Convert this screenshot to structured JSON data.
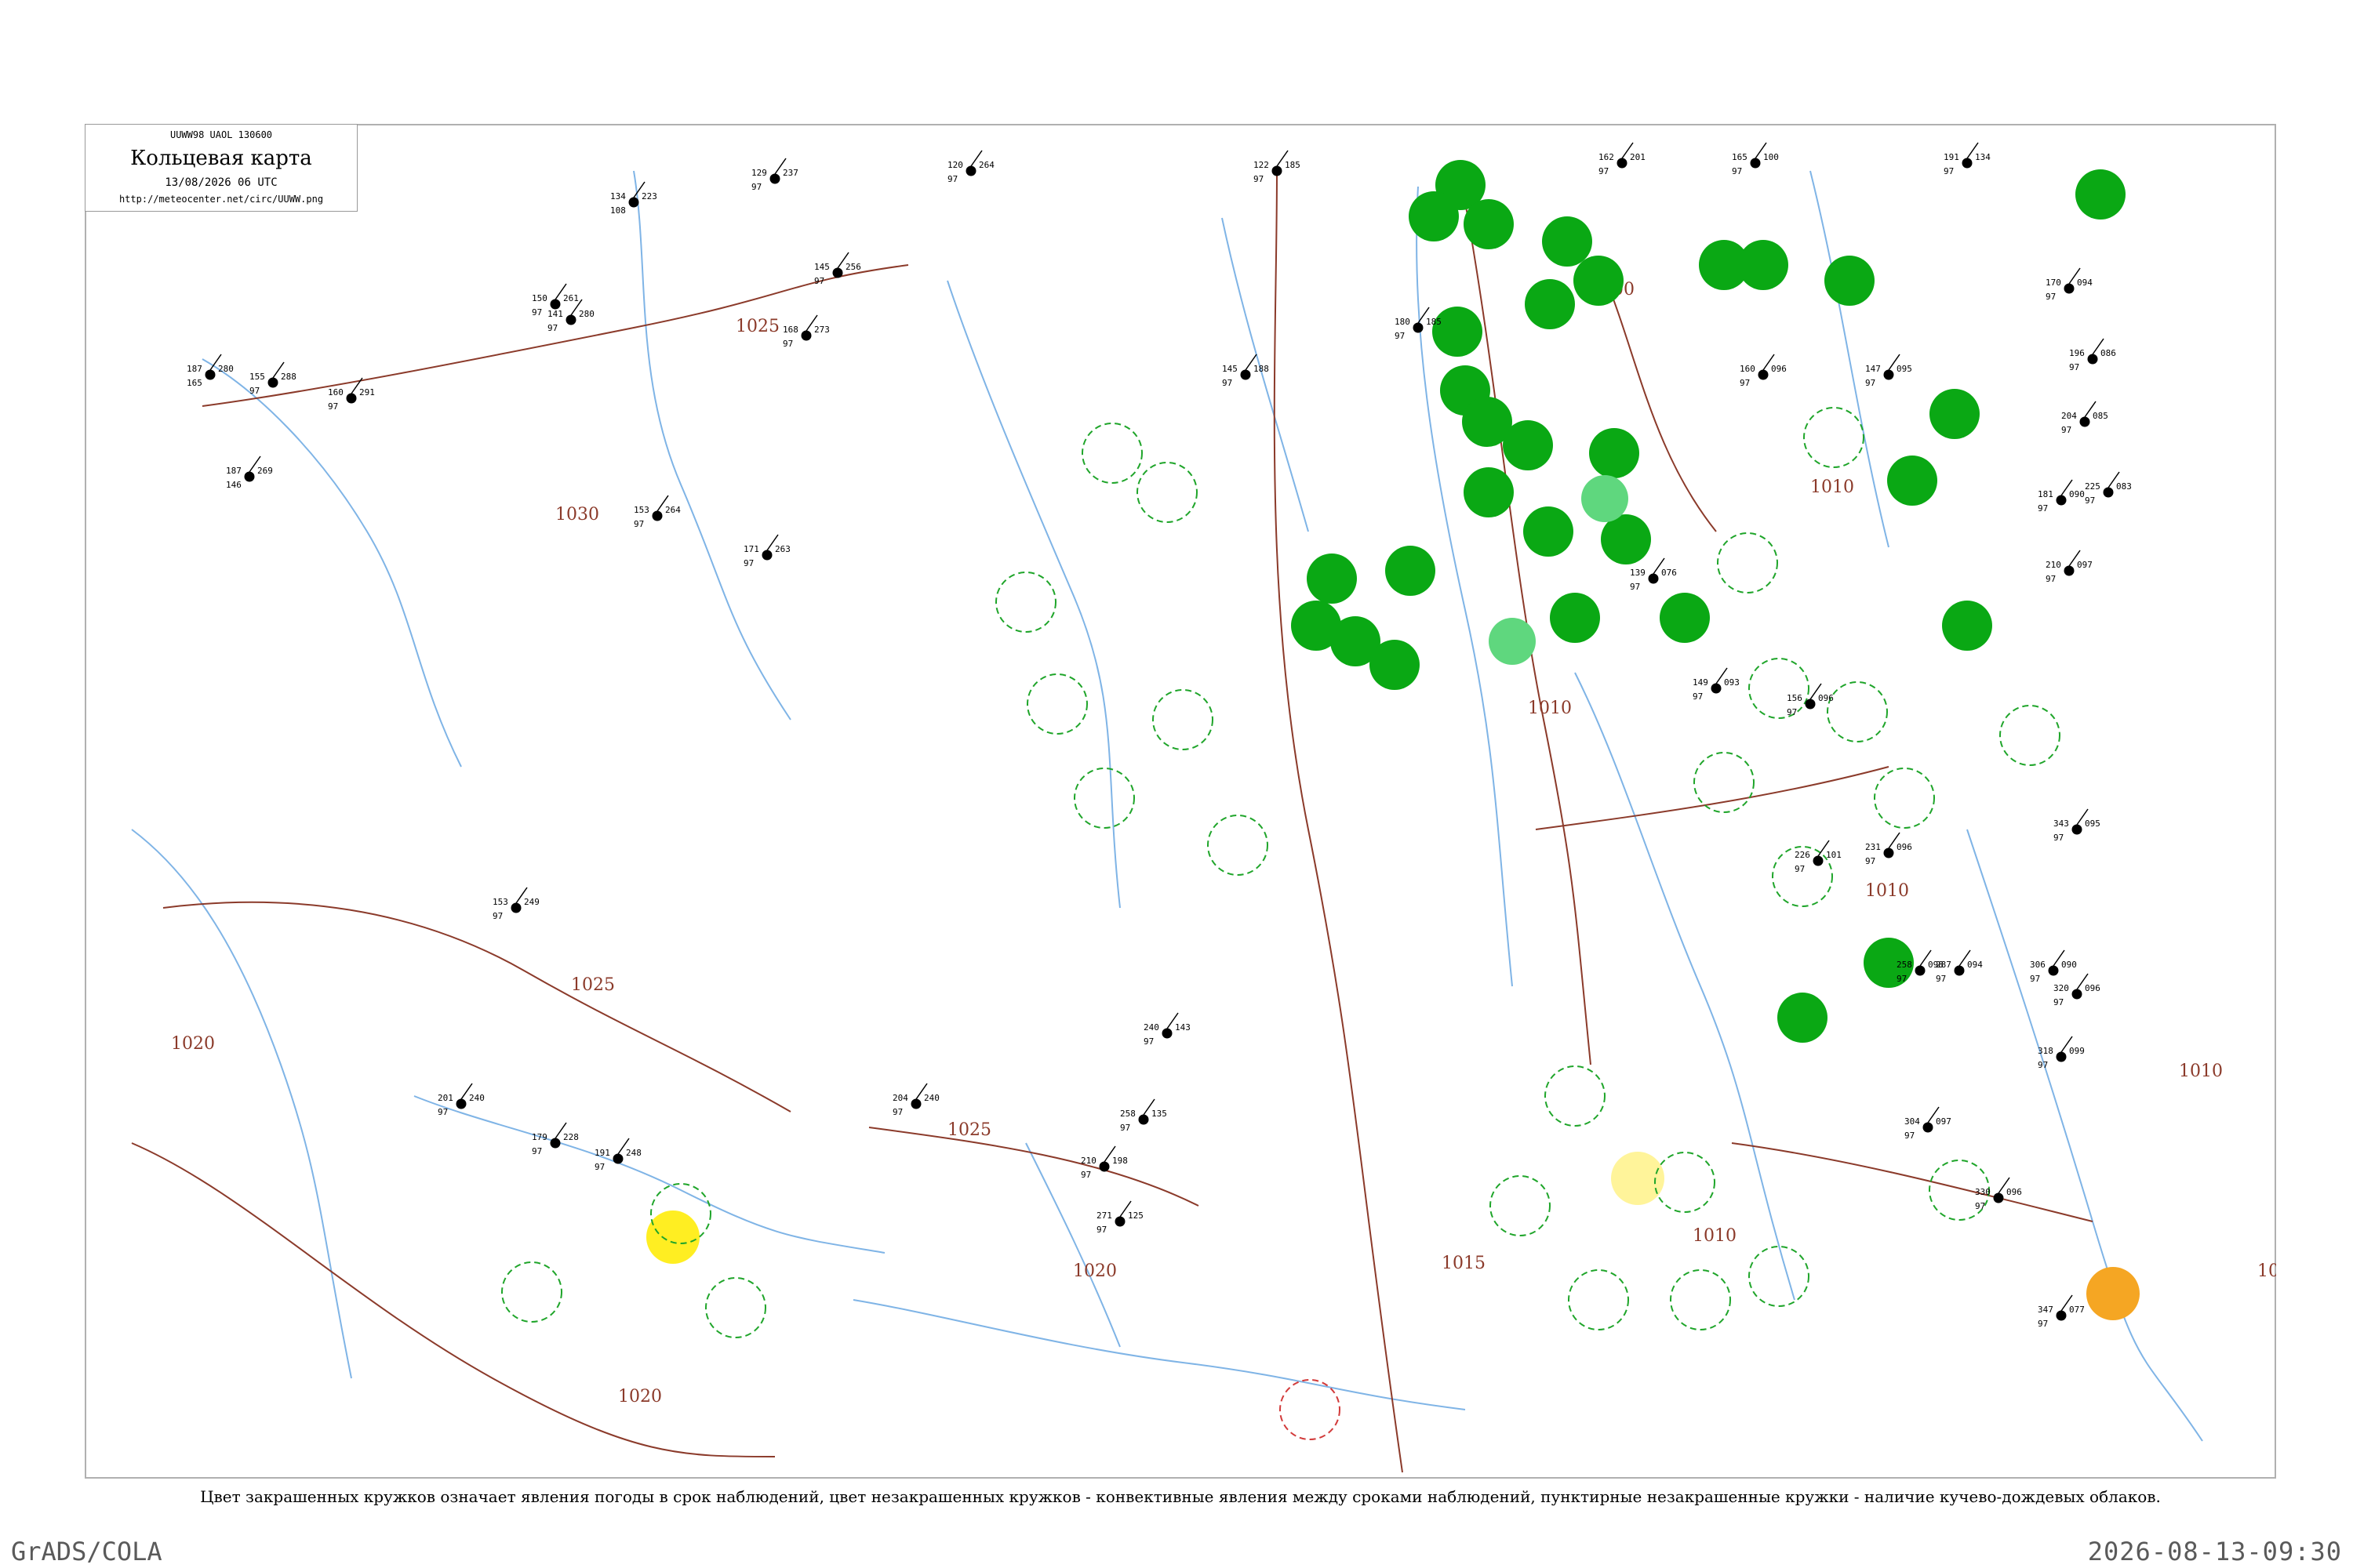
{
  "header": {
    "code": "UUWW98  UAOL  130600",
    "title": "Кольцевая карта",
    "datetime": "13/08/2026 06 UTC",
    "url": "http://meteocenter.net/circ/UUWW.png"
  },
  "caption": "Цвет закрашенных кружков означает явления погоды в срок наблюдений, цвет незакрашенных кружков - конвективные явления между сроками наблюдений, пунктирные незакрашенные кружки - наличие кучево-дождевых облаков.",
  "footer": {
    "software": "GrADS/COLA",
    "timestamp": "2026-08-13-09:30"
  },
  "isobars": [
    "1030",
    "1025",
    "1025",
    "1025",
    "1020",
    "1020",
    "1020",
    "1015",
    "1010",
    "1010",
    "1010",
    "1010",
    "1000",
    "1010",
    "10"
  ],
  "colors": {
    "frame": "#b0b0b0",
    "river": "#7fb4e6",
    "isobar": "#8b3a2a",
    "rain_fill": "#0aa814",
    "light_rain_fill": "#5fd77e",
    "fog_fill": "#ffee22",
    "haze_fill": "#fff49a",
    "dust_fill": "#f5a623",
    "convective_ring": "#1fa52a",
    "thunder_ring": "#d23a3a",
    "station_text": "#000000"
  },
  "stations": [
    {
      "t": "134",
      "p": "223",
      "d": "108"
    },
    {
      "t": "129",
      "p": "237",
      "d": "97"
    },
    {
      "t": "187",
      "p": "280",
      "d": "165"
    },
    {
      "t": "155",
      "p": "288",
      "d": "97"
    },
    {
      "t": "160",
      "p": "291",
      "d": "97"
    },
    {
      "t": "150",
      "p": "261",
      "d": "97"
    },
    {
      "t": "168",
      "p": "273",
      "d": "97"
    },
    {
      "t": "145",
      "p": "256",
      "d": "97"
    },
    {
      "t": "120",
      "p": "264",
      "d": "97"
    },
    {
      "t": "187",
      "p": "269",
      "d": "146"
    },
    {
      "t": "122",
      "p": "185",
      "d": "97"
    },
    {
      "t": "162",
      "p": "201",
      "d": "97"
    },
    {
      "t": "160",
      "p": "096",
      "d": "97"
    },
    {
      "t": "147",
      "p": "095",
      "d": "97"
    },
    {
      "t": "170",
      "p": "094",
      "d": "97"
    },
    {
      "t": "196",
      "p": "086",
      "d": "97"
    },
    {
      "t": "204",
      "p": "085",
      "d": "97"
    },
    {
      "t": "225",
      "p": "083",
      "d": "97"
    },
    {
      "t": "181",
      "p": "090",
      "d": "97"
    },
    {
      "t": "210",
      "p": "097",
      "d": "97"
    },
    {
      "t": "180",
      "p": "185",
      "d": "97"
    },
    {
      "t": "145",
      "p": "188",
      "d": "97"
    },
    {
      "t": "191",
      "p": "134",
      "d": "97"
    },
    {
      "t": "153",
      "p": "249",
      "d": "97"
    },
    {
      "t": "165",
      "p": "100",
      "d": "97"
    },
    {
      "t": "141",
      "p": "280",
      "d": "97"
    },
    {
      "t": "153",
      "p": "264",
      "d": "97"
    },
    {
      "t": "171",
      "p": "263",
      "d": "97"
    },
    {
      "t": "139",
      "p": "076",
      "d": "97"
    },
    {
      "t": "149",
      "p": "093",
      "d": "97"
    },
    {
      "t": "156",
      "p": "096",
      "d": "97"
    },
    {
      "t": "226",
      "p": "101",
      "d": "97"
    },
    {
      "t": "231",
      "p": "096",
      "d": "97"
    },
    {
      "t": "258",
      "p": "098",
      "d": "97"
    },
    {
      "t": "287",
      "p": "094",
      "d": "97"
    },
    {
      "t": "306",
      "p": "090",
      "d": "97"
    },
    {
      "t": "320",
      "p": "096",
      "d": "97"
    },
    {
      "t": "343",
      "p": "095",
      "d": "97"
    },
    {
      "t": "318",
      "p": "099",
      "d": "97"
    },
    {
      "t": "304",
      "p": "097",
      "d": "97"
    },
    {
      "t": "330",
      "p": "096",
      "d": "97"
    },
    {
      "t": "347",
      "p": "077",
      "d": "97"
    },
    {
      "t": "271",
      "p": "125",
      "d": "97"
    },
    {
      "t": "258",
      "p": "135",
      "d": "97"
    },
    {
      "t": "240",
      "p": "143",
      "d": "97"
    },
    {
      "t": "210",
      "p": "198",
      "d": "97"
    },
    {
      "t": "204",
      "p": "240",
      "d": "97"
    },
    {
      "t": "201",
      "p": "240",
      "d": "97"
    },
    {
      "t": "179",
      "p": "228",
      "d": "97"
    },
    {
      "t": "191",
      "p": "248",
      "d": "97"
    }
  ]
}
